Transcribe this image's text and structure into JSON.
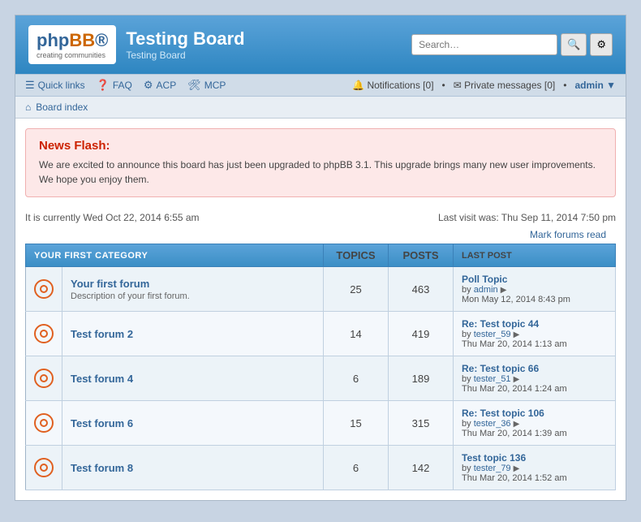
{
  "header": {
    "logo_text": "php",
    "logo_text_bold": "BB",
    "logo_tagline": "creating communities",
    "board_title": "Testing Board",
    "board_subtitle": "Testing Board",
    "search_placeholder": "Search…"
  },
  "navbar": {
    "quick_links": "Quick links",
    "faq": "FAQ",
    "acp": "ACP",
    "mcp": "MCP",
    "notifications_label": "Notifications",
    "notifications_count": "0",
    "private_messages_label": "Private messages",
    "private_messages_count": "0",
    "admin_user": "admin"
  },
  "breadcrumb": {
    "home_label": "Board index"
  },
  "news_flash": {
    "title": "News Flash:",
    "text": "We are excited to announce this board has just been upgraded to phpBB 3.1. This upgrade brings many new user improvements. We hope you enjoy them."
  },
  "status": {
    "current_time": "It is currently Wed Oct 22, 2014 6:55 am",
    "last_visit": "Last visit was: Thu Sep 11, 2014 7:50 pm",
    "mark_read": "Mark forums read"
  },
  "forum_table": {
    "category_label": "YOUR FIRST CATEGORY",
    "col_topics": "TOPICS",
    "col_posts": "POSTS",
    "col_last_post": "LAST POST",
    "forums": [
      {
        "name": "Your first forum",
        "description": "Description of your first forum.",
        "topics": "25",
        "posts": "463",
        "last_post_title": "Poll Topic",
        "last_post_by": "by",
        "last_post_user": "admin",
        "last_post_date": "Mon May 12, 2014 8:43 pm"
      },
      {
        "name": "Test forum 2",
        "description": "",
        "topics": "14",
        "posts": "419",
        "last_post_title": "Re: Test topic 44",
        "last_post_by": "by",
        "last_post_user": "tester_59",
        "last_post_date": "Thu Mar 20, 2014 1:13 am"
      },
      {
        "name": "Test forum 4",
        "description": "",
        "topics": "6",
        "posts": "189",
        "last_post_title": "Re: Test topic 66",
        "last_post_by": "by",
        "last_post_user": "tester_51",
        "last_post_date": "Thu Mar 20, 2014 1:24 am"
      },
      {
        "name": "Test forum 6",
        "description": "",
        "topics": "15",
        "posts": "315",
        "last_post_title": "Re: Test topic 106",
        "last_post_by": "by",
        "last_post_user": "tester_36",
        "last_post_date": "Thu Mar 20, 2014 1:39 am"
      },
      {
        "name": "Test forum 8",
        "description": "",
        "topics": "6",
        "posts": "142",
        "last_post_title": "Test topic 136",
        "last_post_by": "by",
        "last_post_user": "tester_79",
        "last_post_date": "Thu Mar 20, 2014 1:52 am"
      }
    ]
  }
}
